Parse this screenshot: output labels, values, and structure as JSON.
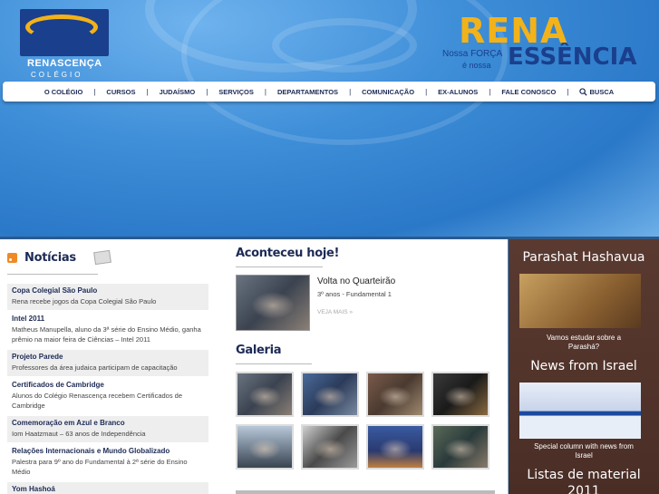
{
  "logo": {
    "name": "RENASCENÇA",
    "sub": "COLÉGIO"
  },
  "slogan": {
    "big1": "RENA",
    "big2": "ESSÊNCIA",
    "small1": "Nossa FORÇA",
    "small2": "é nossa"
  },
  "nav": {
    "items": [
      "O COLÉGIO",
      "CURSOS",
      "JUDAÍSMO",
      "SERVIÇOS",
      "DEPARTAMENTOS",
      "COMUNICAÇÃO",
      "EX-ALUNOS",
      "FALE CONOSCO"
    ],
    "search": "BUSCA"
  },
  "news": {
    "title": "Notícias",
    "items": [
      {
        "title": "Copa Colegial São Paulo",
        "text": "Rena recebe jogos da Copa Colegial São Paulo"
      },
      {
        "title": "Intel 2011",
        "text": "Matheus Manupella, aluno da 3ª série do Ensino Médio, ganha prêmio na maior feira de Ciências – Intel 2011"
      },
      {
        "title": "Projeto Parede",
        "text": "Professores da área judaica participam de capacitação"
      },
      {
        "title": "Certificados de Cambridge",
        "text": "Alunos do Colégio Renascença recebem Certificados de Cambridge"
      },
      {
        "title": "Comemoração em Azul e Branco",
        "text": "Iom Haatzmaut – 63 anos de Independência"
      },
      {
        "title": "Relações Internacionais e Mundo Globalizado",
        "text": "Palestra para 9º ano do Fundamental à 2ª série do Ensino Médio"
      },
      {
        "title": "Yom Hashoá",
        "text": ""
      }
    ]
  },
  "today": {
    "title": "Aconteceu hoje!",
    "feature_title": "Volta no Quarteirão",
    "feature_sub": "3º anos - Fundamental 1",
    "feature_more": "VEJA MAIS »"
  },
  "gallery": {
    "title": "Galeria",
    "count": 8
  },
  "sidebar": {
    "parashat_title": "Parashat Hashavua",
    "parashat_caption": "Vamos estudar sobre a Parashá?",
    "israel_title": "News from Israel",
    "israel_caption": "Special column with news from Israel",
    "listas_title": "Listas de material",
    "listas_year": "2011"
  },
  "colors": {
    "accent": "#f2b21a",
    "navy": "#1c2a55",
    "sky": "#3e8ed8"
  }
}
